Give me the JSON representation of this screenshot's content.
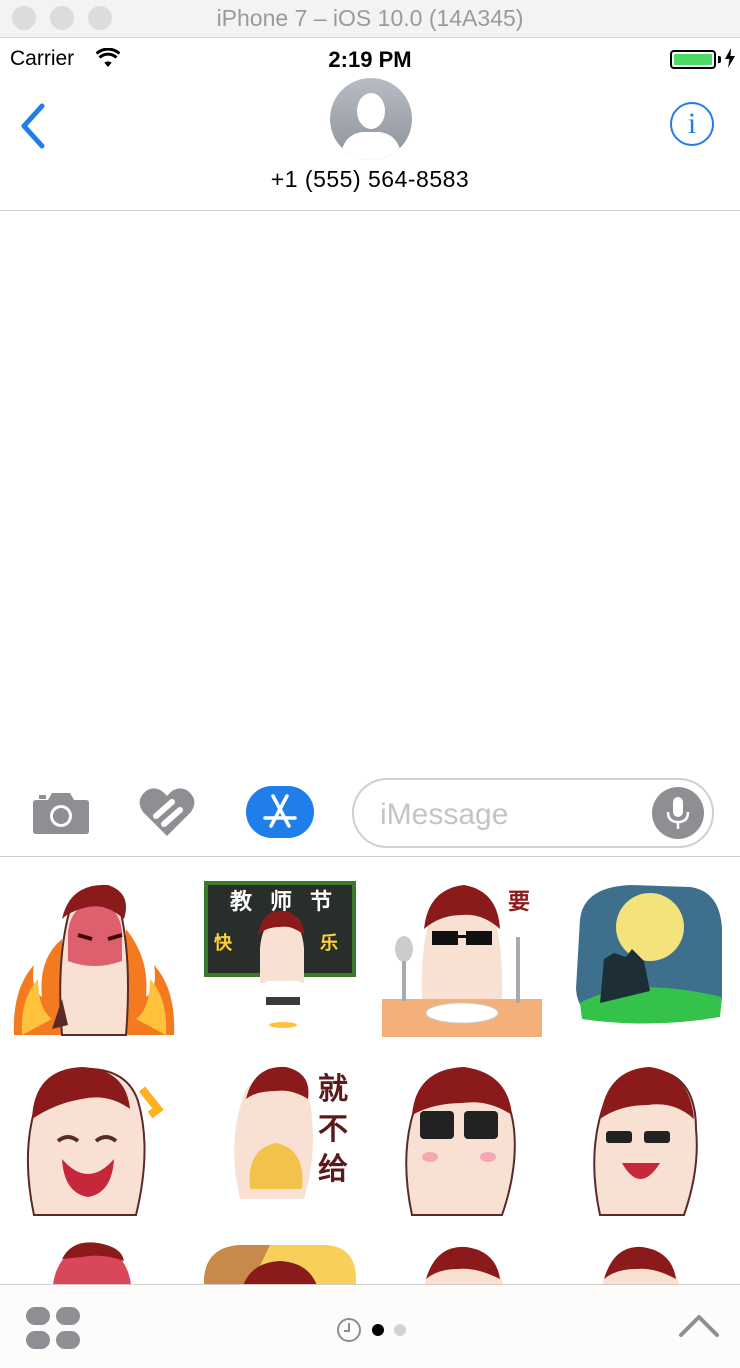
{
  "simulator": {
    "title": "iPhone 7 – iOS 10.0 (14A345)"
  },
  "status_bar": {
    "carrier": "Carrier",
    "time": "2:19 PM"
  },
  "conversation": {
    "contact": "+1 (555) 564-8583"
  },
  "composer": {
    "placeholder": "iMessage"
  },
  "sticker_pack": {
    "stickers": [
      {
        "name": "angry-fire-sticker"
      },
      {
        "name": "teachers-day-sticker",
        "text": [
          "教",
          "师",
          "节",
          "快",
          "乐"
        ]
      },
      {
        "name": "want-to-eat-sticker",
        "text": [
          "要"
        ]
      },
      {
        "name": "moon-night-sticker"
      },
      {
        "name": "laughing-tongue-sticker"
      },
      {
        "name": "wont-give-sticker",
        "text": [
          "就",
          "不",
          "给"
        ]
      },
      {
        "name": "sunglasses-kiss-sticker"
      },
      {
        "name": "glasses-grin-sticker"
      }
    ],
    "page_count": 2,
    "current_page": 1
  },
  "colors": {
    "accent": "#1f7ee9",
    "battery": "#4cd964",
    "hair": "#8b1a1a",
    "skin": "#f8e1d3"
  },
  "icons": [
    "back-chevron-icon",
    "person-icon",
    "info-icon",
    "camera-icon",
    "digital-touch-icon",
    "app-store-icon",
    "microphone-icon",
    "app-drawer-icon",
    "recents-clock-icon",
    "expand-chevron-icon"
  ]
}
